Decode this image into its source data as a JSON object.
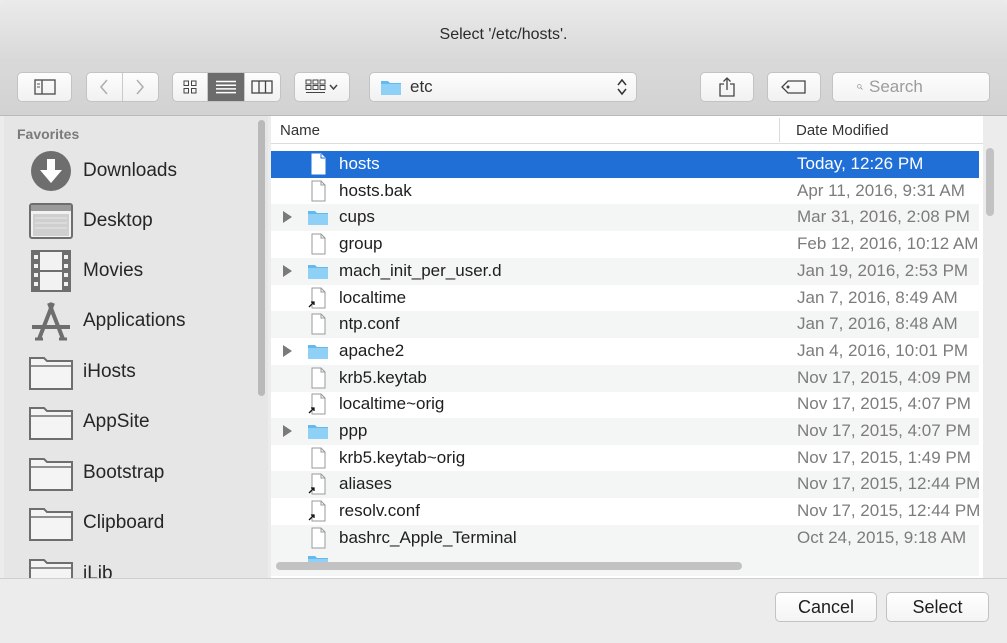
{
  "window": {
    "title": "Select '/etc/hosts'."
  },
  "toolbar": {
    "path_label": "etc",
    "search_placeholder": "Search",
    "view_mode": "list",
    "icons": [
      "sidebar-toggle-icon",
      "back-icon",
      "forward-icon",
      "icon-view-icon",
      "list-view-icon",
      "column-view-icon",
      "arrange-icon",
      "share-icon",
      "tag-icon",
      "search-icon"
    ]
  },
  "sidebar": {
    "heading": "Favorites",
    "items": [
      {
        "label": "Downloads",
        "icon": "downloads-icon"
      },
      {
        "label": "Desktop",
        "icon": "desktop-icon"
      },
      {
        "label": "Movies",
        "icon": "movies-icon"
      },
      {
        "label": "Applications",
        "icon": "applications-icon"
      },
      {
        "label": "iHosts",
        "icon": "folder-icon"
      },
      {
        "label": "AppSite",
        "icon": "folder-icon"
      },
      {
        "label": "Bootstrap",
        "icon": "folder-icon"
      },
      {
        "label": "Clipboard",
        "icon": "folder-icon"
      },
      {
        "label": "iLib",
        "icon": "folder-icon"
      }
    ]
  },
  "filelist": {
    "columns": {
      "name": "Name",
      "date": "Date Modified"
    },
    "rows": [
      {
        "name": "hosts",
        "date": "Today, 12:26 PM",
        "type": "file",
        "selected": true
      },
      {
        "name": "hosts.bak",
        "date": "Apr 11, 2016, 9:31 AM",
        "type": "file"
      },
      {
        "name": "cups",
        "date": "Mar 31, 2016, 2:08 PM",
        "type": "folder"
      },
      {
        "name": "group",
        "date": "Feb 12, 2016, 10:12 AM",
        "type": "file"
      },
      {
        "name": "mach_init_per_user.d",
        "date": "Jan 19, 2016, 2:53 PM",
        "type": "folder"
      },
      {
        "name": "localtime",
        "date": "Jan 7, 2016, 8:49 AM",
        "type": "alias"
      },
      {
        "name": "ntp.conf",
        "date": "Jan 7, 2016, 8:48 AM",
        "type": "file"
      },
      {
        "name": "apache2",
        "date": "Jan 4, 2016, 10:01 PM",
        "type": "folder"
      },
      {
        "name": "krb5.keytab",
        "date": "Nov 17, 2015, 4:09 PM",
        "type": "file"
      },
      {
        "name": "localtime~orig",
        "date": "Nov 17, 2015, 4:07 PM",
        "type": "alias"
      },
      {
        "name": "ppp",
        "date": "Nov 17, 2015, 4:07 PM",
        "type": "folder"
      },
      {
        "name": "krb5.keytab~orig",
        "date": "Nov 17, 2015, 1:49 PM",
        "type": "file"
      },
      {
        "name": "aliases",
        "date": "Nov 17, 2015, 12:44 PM",
        "type": "alias"
      },
      {
        "name": "resolv.conf",
        "date": "Nov 17, 2015, 12:44 PM",
        "type": "alias"
      },
      {
        "name": "bashrc_Apple_Terminal",
        "date": "Oct 24, 2015, 9:18 AM",
        "type": "file"
      }
    ]
  },
  "buttons": {
    "cancel": "Cancel",
    "select": "Select"
  },
  "colors": {
    "selection": "#1f6fd6",
    "folder": "#64b9f0",
    "window_bg": "#ececec"
  }
}
